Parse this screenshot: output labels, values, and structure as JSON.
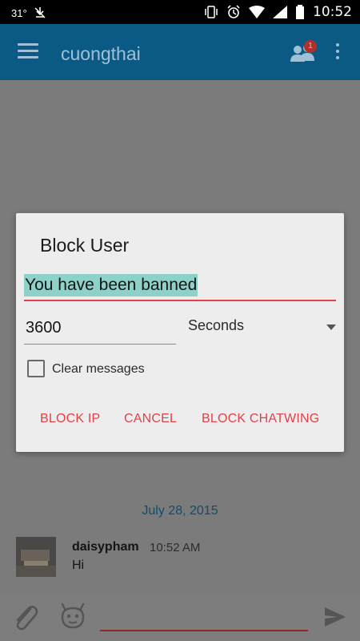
{
  "status_bar": {
    "temperature": "31°",
    "time": "10:52",
    "icons": [
      "download-off-icon",
      "vibrate-icon",
      "alarm-icon",
      "wifi-icon",
      "signal-icon",
      "battery-icon"
    ]
  },
  "app_bar": {
    "title": "cuongthai",
    "notification_badge": "1",
    "color": "#0b5a85"
  },
  "dialog": {
    "title": "Block User",
    "reason": "You have been banned",
    "duration_value": "3600",
    "duration_unit": "Seconds",
    "clear_messages_label": "Clear messages",
    "clear_messages_checked": false,
    "buttons": {
      "block_ip": "BLOCK IP",
      "cancel": "CANCEL",
      "block_chatwing": "BLOCK CHATWING"
    },
    "accent_color": "#e0414a"
  },
  "chat": {
    "date_separator": "July 28, 2015",
    "messages": [
      {
        "user": "daisypham",
        "time": "10:52 AM",
        "text": "Hi"
      }
    ]
  },
  "input_bar": {
    "message_value": ""
  }
}
